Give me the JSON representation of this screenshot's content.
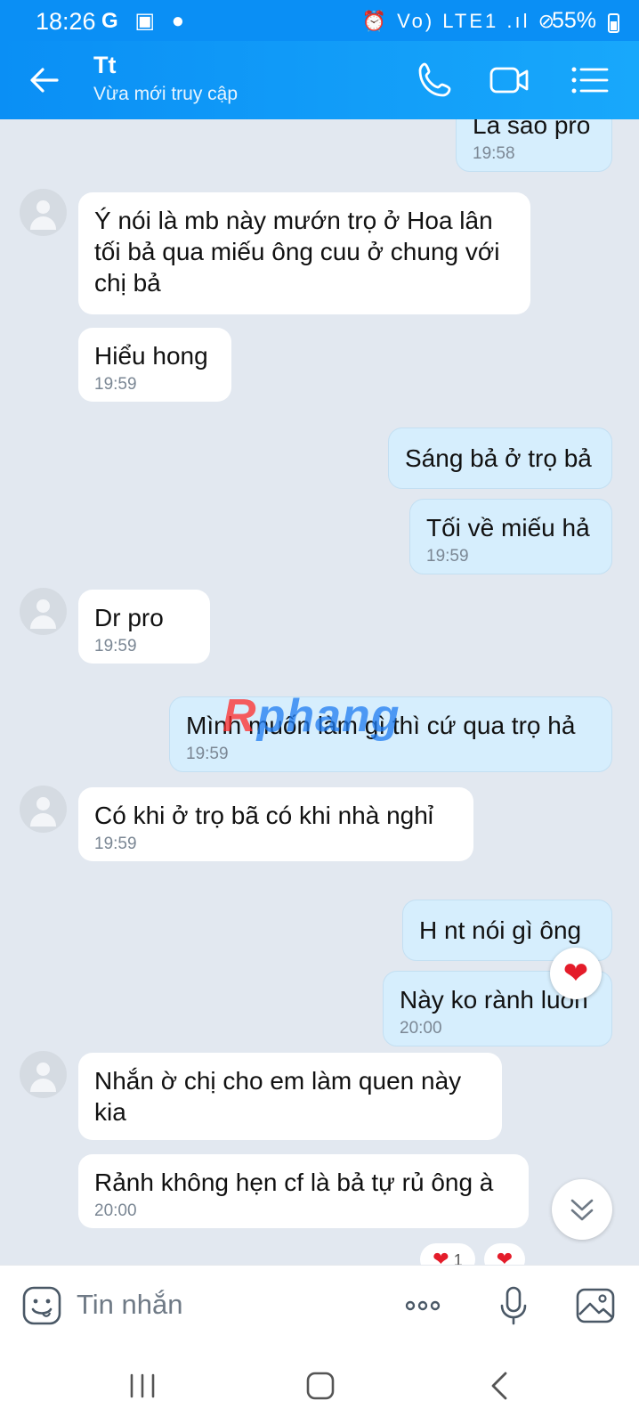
{
  "status_bar": {
    "time": "18:26",
    "left_icons": "G ▣ ●",
    "right_icons": "⏰ Vo) LTE1 .ıl ⊘",
    "battery": "55%"
  },
  "header": {
    "contact_name": "Tt",
    "status": "Vừa mới truy cập"
  },
  "messages": [
    {
      "dir": "out",
      "text": "Là sao pro",
      "time": "19:58"
    },
    {
      "dir": "in",
      "text": "Ý nói là mb này mướn trọ ở Hoa lân tối bả qua miếu ông cuu ở chung với chị bả",
      "time": ""
    },
    {
      "dir": "in",
      "text": "Hiểu hong",
      "time": "19:59"
    },
    {
      "dir": "out",
      "text": "Sáng bả ở trọ bả",
      "time": ""
    },
    {
      "dir": "out",
      "text": "Tối về miếu hả",
      "time": "19:59"
    },
    {
      "dir": "in",
      "text": "Dr pro",
      "time": "19:59"
    },
    {
      "dir": "out",
      "text": "Mình muốn làm gì thì cứ qua trọ hả",
      "time": "19:59"
    },
    {
      "dir": "in",
      "text": "Có khi ở trọ bã có khi nhà nghỉ",
      "time": "19:59"
    },
    {
      "dir": "out",
      "text": "H nt nói gì ông",
      "time": ""
    },
    {
      "dir": "out",
      "text": "Này ko rành luôn",
      "time": "20:00"
    },
    {
      "dir": "in",
      "text": "Nhắn ờ chị cho em làm quen này kia",
      "time": ""
    },
    {
      "dir": "in",
      "text": "Rảnh không hẹn cf là bả tự rủ ông à",
      "time": "20:00"
    }
  ],
  "reactions": {
    "heart": "❤",
    "count": "1"
  },
  "watermark": {
    "part1": "R",
    "part2": "phang"
  },
  "composer": {
    "placeholder": "Tin nhắn"
  },
  "colors": {
    "header": "#0a8ff5",
    "outgoing": "#d6eefd",
    "incoming": "#ffffff",
    "background": "#e2e8f0"
  }
}
